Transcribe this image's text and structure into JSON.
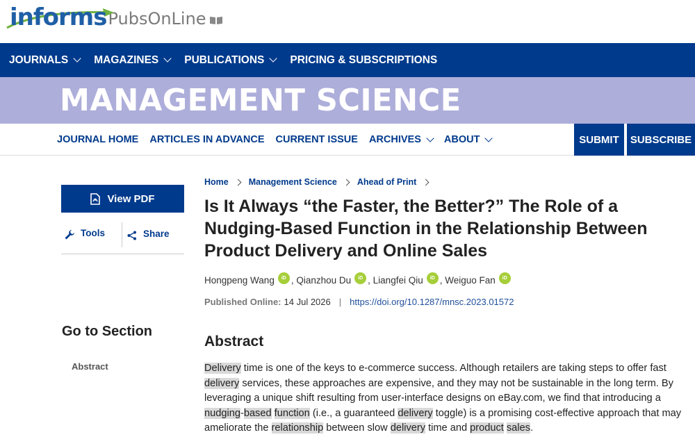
{
  "header": {
    "logo_informs": "informs",
    "logo_pubs": "PubsOnLine"
  },
  "topnav": {
    "items": [
      "JOURNALS",
      "MAGAZINES",
      "PUBLICATIONS",
      "PRICING & SUBSCRIPTIONS"
    ]
  },
  "banner": {
    "title": "MANAGEMENT SCIENCE"
  },
  "journal_nav": {
    "items": [
      "JOURNAL HOME",
      "ARTICLES IN ADVANCE",
      "CURRENT ISSUE",
      "ARCHIVES",
      "ABOUT"
    ],
    "submit": "SUBMIT",
    "subscribe": "SUBSCRIBE"
  },
  "sidebar": {
    "view_pdf": "View PDF",
    "tools": "Tools",
    "share": "Share",
    "go_to_section": "Go to Section",
    "sections": [
      "Abstract"
    ]
  },
  "breadcrumb": [
    "Home",
    "Management Science",
    "Ahead of Print"
  ],
  "article": {
    "title": "Is It Always “the Faster, the Better?” The Role of a Nudging-Based Function in the Relationship Between Product Delivery and Online Sales",
    "authors": [
      "Hongpeng Wang",
      "Qianzhou Du",
      "Liangfei Qiu",
      "Weiguo Fan"
    ],
    "orcid_label": "iD",
    "published_label": "Published Online:",
    "published_date": "14 Jul 2026",
    "doi": "https://doi.org/10.1287/mnsc.2023.01572"
  },
  "abstract": {
    "heading": "Abstract",
    "segments": [
      {
        "t": "Delivery",
        "hl": true
      },
      {
        "t": " time is one of the keys to e-commerce success. Although retailers are taking steps to offer fast ",
        "hl": false
      },
      {
        "t": "delivery",
        "hl": true
      },
      {
        "t": " services, these approaches are expensive, and they may not be sustainable in the long term. By leveraging a unique shift resulting from user-interface designs on eBay.com, we find that introducing a ",
        "hl": false
      },
      {
        "t": "nudging",
        "hl": true
      },
      {
        "t": "-",
        "hl": false
      },
      {
        "t": "based",
        "hl": true
      },
      {
        "t": " ",
        "hl": false
      },
      {
        "t": "function",
        "hl": true
      },
      {
        "t": " (i.e., a guaranteed ",
        "hl": false
      },
      {
        "t": "delivery",
        "hl": true
      },
      {
        "t": " toggle) is a promising cost-effective approach that may ameliorate the ",
        "hl": false
      },
      {
        "t": "relationship",
        "hl": true
      },
      {
        "t": " between slow ",
        "hl": false
      },
      {
        "t": "delivery",
        "hl": true
      },
      {
        "t": " time and ",
        "hl": false
      },
      {
        "t": "product",
        "hl": true
      },
      {
        "t": " ",
        "hl": false
      },
      {
        "t": "sales",
        "hl": true
      },
      {
        "t": ".",
        "hl": false
      }
    ]
  },
  "colors": {
    "primary": "#003a8c",
    "banner": "#aeaedb",
    "orcid": "#a6ce39",
    "highlight": "#d9d9d9"
  }
}
